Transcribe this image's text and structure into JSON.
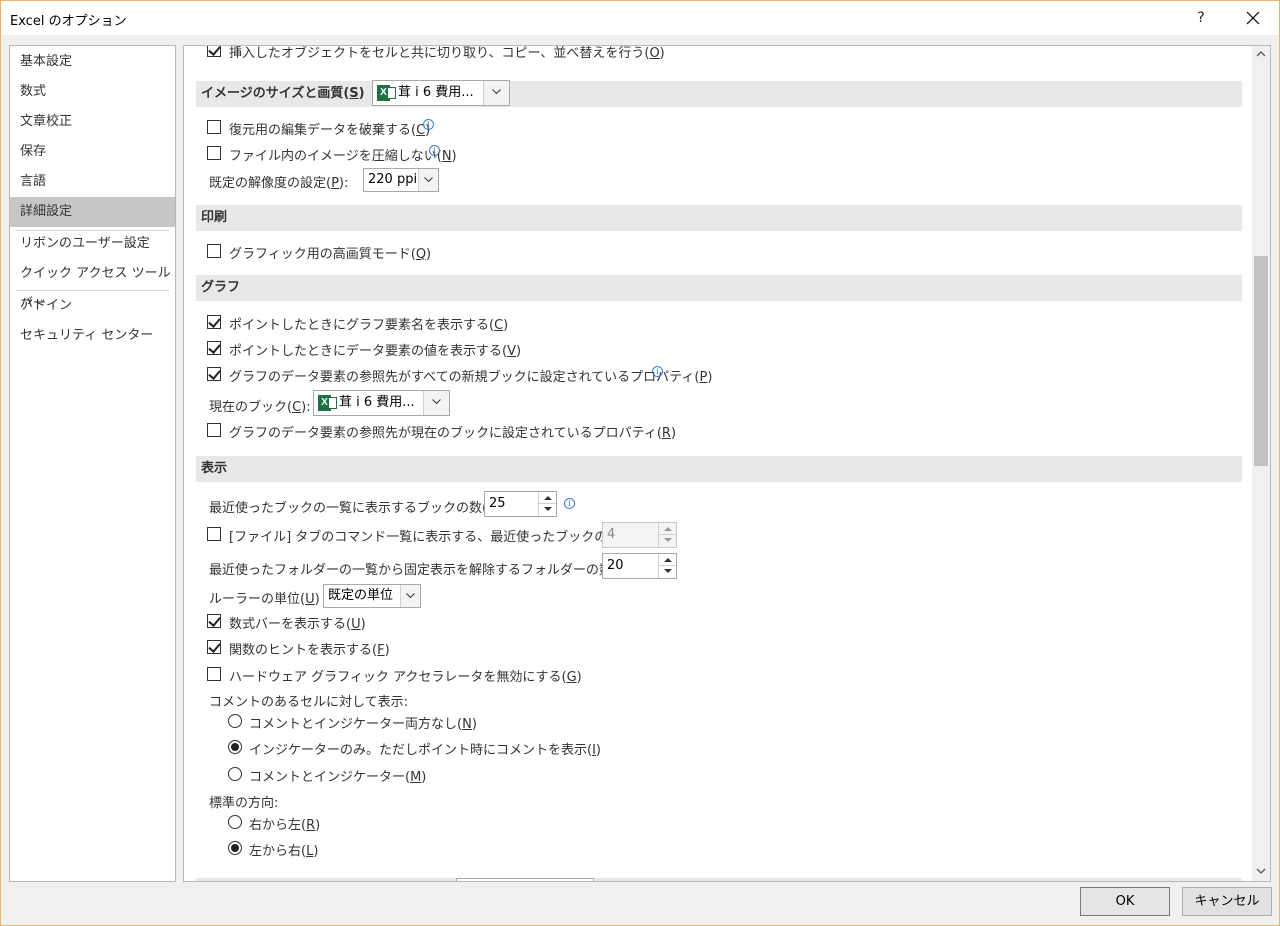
{
  "window": {
    "title": "Excel のオプション",
    "help": "?"
  },
  "sidebar": {
    "items": [
      {
        "label": "基本設定"
      },
      {
        "label": "数式"
      },
      {
        "label": "文章校正"
      },
      {
        "label": "保存"
      },
      {
        "label": "言語"
      },
      {
        "label": "詳細設定",
        "active": true
      },
      {
        "label": "リボンのユーザー設定"
      },
      {
        "label": "クイック アクセス ツール バー"
      },
      {
        "label": "アドイン"
      },
      {
        "label": "セキュリティ センター"
      }
    ]
  },
  "content": {
    "top_cut_option": {
      "text": "挿入したオブジェクトをセルと共に切り取り、コピー、並べ替えを行う(",
      "key": "O",
      "tail": ")",
      "checked": true
    },
    "image_section": {
      "title": "イメージのサイズと画質(",
      "key": "S",
      "tail": ")",
      "workbook_combo": "茸 i 6 費用...",
      "discard_edit": {
        "text": "復元用の編集データを破棄する(",
        "key": "C",
        "tail": ")",
        "checked": false
      },
      "no_compress": {
        "text": "ファイル内のイメージを圧縮しない(",
        "key": "N",
        "tail": ")",
        "checked": false
      },
      "resolution_label": "既定の解像度の設定(",
      "resolution_key": "P",
      "resolution_tail": "):",
      "resolution_value": "220 ppi"
    },
    "print_section": {
      "title": "印刷",
      "hq_mode": {
        "text": "グラフィック用の高画質モード(",
        "key": "Q",
        "tail": ")",
        "checked": false
      }
    },
    "chart_section": {
      "title": "グラフ",
      "show_element_name": {
        "text": "ポイントしたときにグラフ要素名を表示する(",
        "key": "C",
        "tail": ")",
        "checked": true
      },
      "show_data_value": {
        "text": "ポイントしたときにデータ要素の値を表示する(",
        "key": "V",
        "tail": ")",
        "checked": true
      },
      "ref_all_new": {
        "text": "グラフのデータ要素の参照先がすべての新規ブックに設定されているプロパティ(",
        "key": "P",
        "tail": ")",
        "checked": true
      },
      "current_book_label": "現在のブック(",
      "current_book_key": "C",
      "current_book_tail": "):",
      "current_book_combo": "茸 i 6 費用...",
      "ref_current": {
        "text": "グラフのデータ要素の参照先が現在のブックに設定されているプロパティ(",
        "key": "R",
        "tail": ")",
        "checked": false
      }
    },
    "display_section": {
      "title": "表示",
      "recent_books_label": "最近使ったブックの一覧に表示するブックの数(",
      "recent_books_key": "R",
      "recent_books_tail": "):",
      "recent_books_value": "25",
      "file_tab_label": "[ファイル] タブのコマンド一覧に表示する、最近使ったブックの数(",
      "file_tab_key": "Q",
      "file_tab_tail": "):",
      "file_tab_checked": false,
      "file_tab_value": "4",
      "recent_folders_label": "最近使ったフォルダーの一覧から固定表示を解除するフォルダーの数(",
      "recent_folders_key": "F",
      "recent_folders_tail": "):",
      "recent_folders_value": "20",
      "ruler_label": "ルーラーの単位(",
      "ruler_key": "U",
      "ruler_tail": ")",
      "ruler_value": "既定の単位",
      "formula_bar": {
        "text": "数式バーを表示する(",
        "key": "U",
        "tail": ")",
        "checked": true
      },
      "func_tips": {
        "text": "関数のヒントを表示する(",
        "key": "F",
        "tail": ")",
        "checked": true
      },
      "hw_accel": {
        "text": "ハードウェア グラフィック アクセラレータを無効にする(",
        "key": "G",
        "tail": ")",
        "checked": false
      },
      "comments_label": "コメントのあるセルに対して表示:",
      "comment_none": {
        "text": "コメントとインジケーター両方なし(",
        "key": "N",
        "tail": ")",
        "selected": false
      },
      "comment_indicator": {
        "text": "インジケーターのみ。ただしポイント時にコメントを表示(",
        "key": "I",
        "tail": ")",
        "selected": true
      },
      "comment_both": {
        "text": "コメントとインジケーター(",
        "key": "M",
        "tail": ")",
        "selected": false
      },
      "direction_label": "標準の方向:",
      "dir_rtl": {
        "text": "右から左(",
        "key": "R",
        "tail": ")",
        "selected": false
      },
      "dir_ltr": {
        "text": "左から右(",
        "key": "L",
        "tail": ")",
        "selected": true
      }
    }
  },
  "footer": {
    "ok": "OK",
    "cancel": "キャンセル"
  }
}
